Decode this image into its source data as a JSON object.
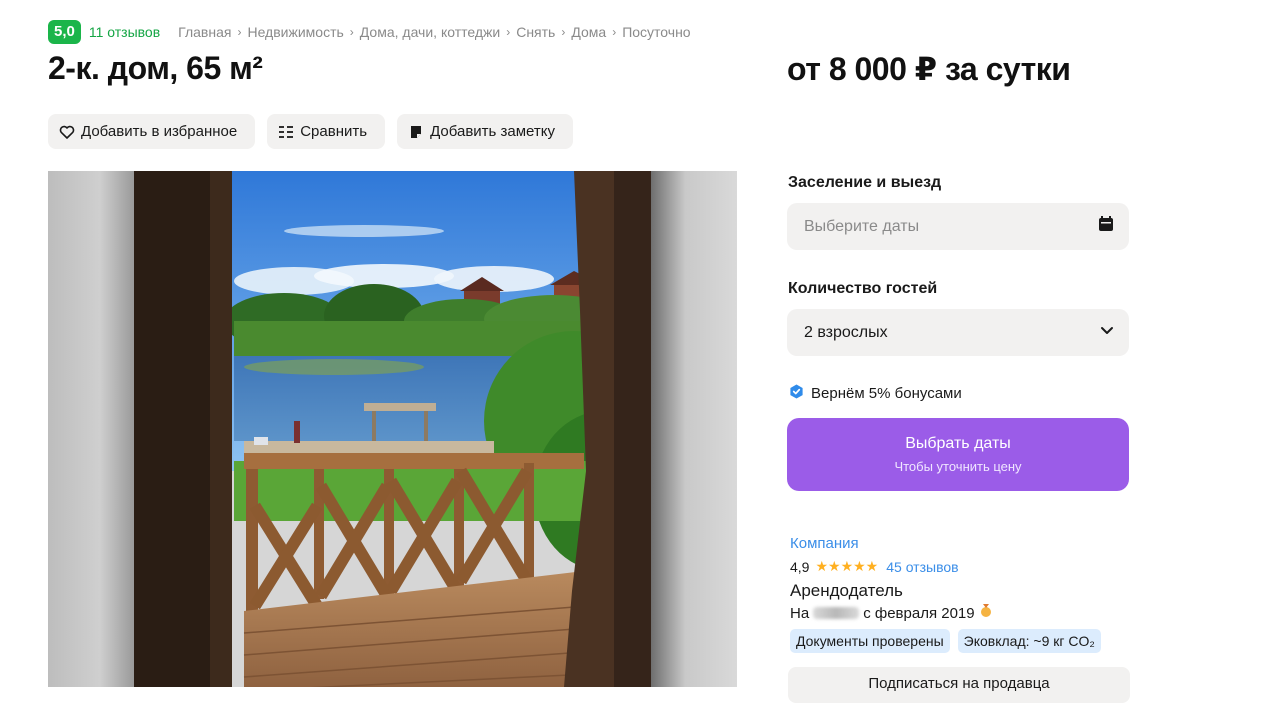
{
  "rating": {
    "score": "5,0",
    "reviews": "11 отзывов"
  },
  "breadcrumbs": [
    "Главная",
    "Недвижимость",
    "Дома, дачи, коттеджи",
    "Снять",
    "Дома",
    "Посуточно"
  ],
  "listing": {
    "title": "2-к. дом, 65 м²",
    "price": "от 8 000 ₽ за сутки"
  },
  "actions": {
    "favorite": "Добавить в избранное",
    "compare": "Сравнить",
    "note": "Добавить заметку"
  },
  "booking": {
    "dates_label": "Заселение и выезд",
    "dates_placeholder": "Выберите даты",
    "guests_label": "Количество гостей",
    "guests_value": "2 взрослых",
    "bonus_text": "Вернём 5% бонусами",
    "cta_main": "Выбрать даты",
    "cta_sub": "Чтобы уточнить цену"
  },
  "seller": {
    "type": "Компания",
    "rating": "4,9",
    "stars": "★★★★★",
    "reviews": "45 отзывов",
    "role": "Арендодатель",
    "since_prefix": "На",
    "since_suffix": "с февраля 2019",
    "tags": [
      "Документы проверены",
      "Эковклад: ~9 кг CO₂"
    ],
    "subscribe": "Подписаться на продавца"
  },
  "colors": {
    "accent_green": "#1bb54a",
    "cta_purple": "#9b5ce8",
    "link_blue": "#3b8ee8",
    "tag_bg": "#dcecfd",
    "star": "#ffb021"
  }
}
